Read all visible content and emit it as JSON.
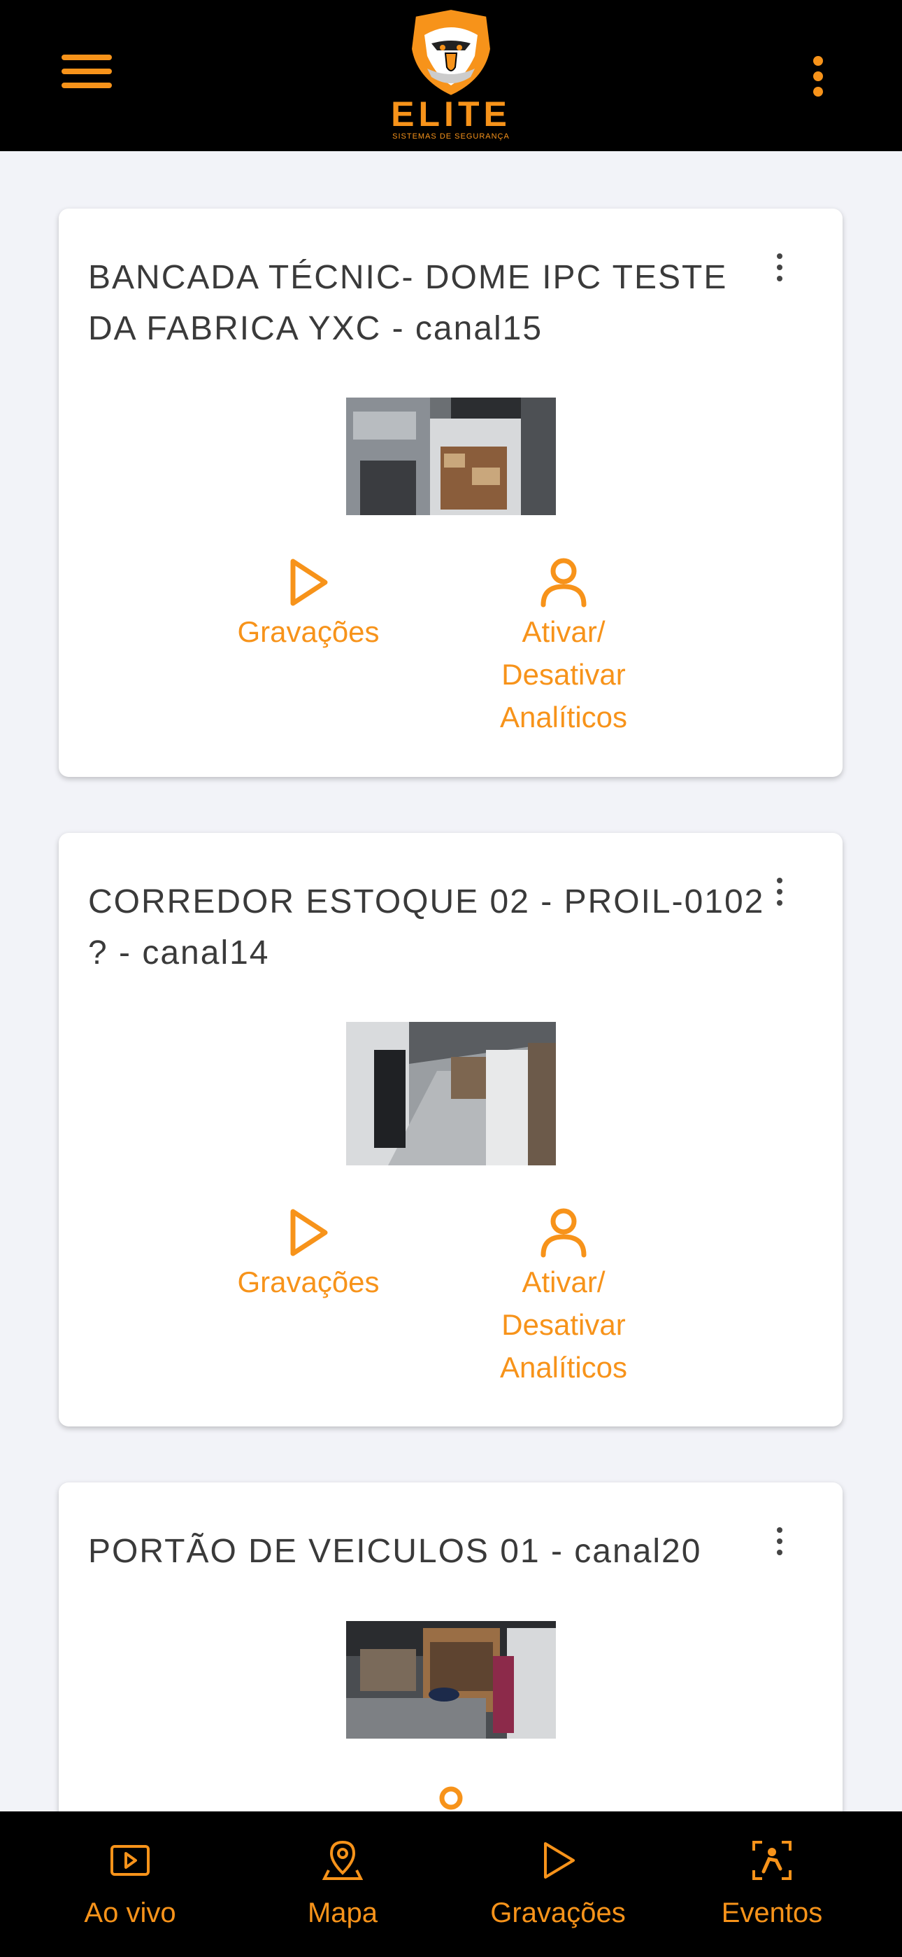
{
  "header": {
    "brand_name": "ELITE",
    "brand_tagline": "SISTEMAS DE SEGURANÇA",
    "menu_icon": "hamburger-menu-icon",
    "more_icon": "more-vertical-icon"
  },
  "cards": [
    {
      "title": "BANCADA TÉCNIC- DOME IPC TESTE DA FABRICA YXC - canal15",
      "recordings_label": "Gravações",
      "analytics_label": "Ativar/ Desativar Analíticos"
    },
    {
      "title": "CORREDOR ESTOQUE 02 - PROIL-0102 ? - canal14",
      "recordings_label": "Gravações",
      "analytics_label": "Ativar/ Desativar Analíticos"
    },
    {
      "title": "PORTÃO DE VEICULOS 01 - canal20"
    }
  ],
  "bottom_nav": [
    {
      "label": "Ao vivo",
      "icon": "live-video-icon"
    },
    {
      "label": "Mapa",
      "icon": "map-pin-icon"
    },
    {
      "label": "Gravações",
      "icon": "play-icon"
    },
    {
      "label": "Eventos",
      "icon": "person-detect-icon"
    }
  ],
  "colors": {
    "accent": "#f7931a",
    "header_bg": "#000000",
    "page_bg": "#f2f3f8",
    "card_bg": "#ffffff",
    "title_text": "#3a3a3a"
  }
}
